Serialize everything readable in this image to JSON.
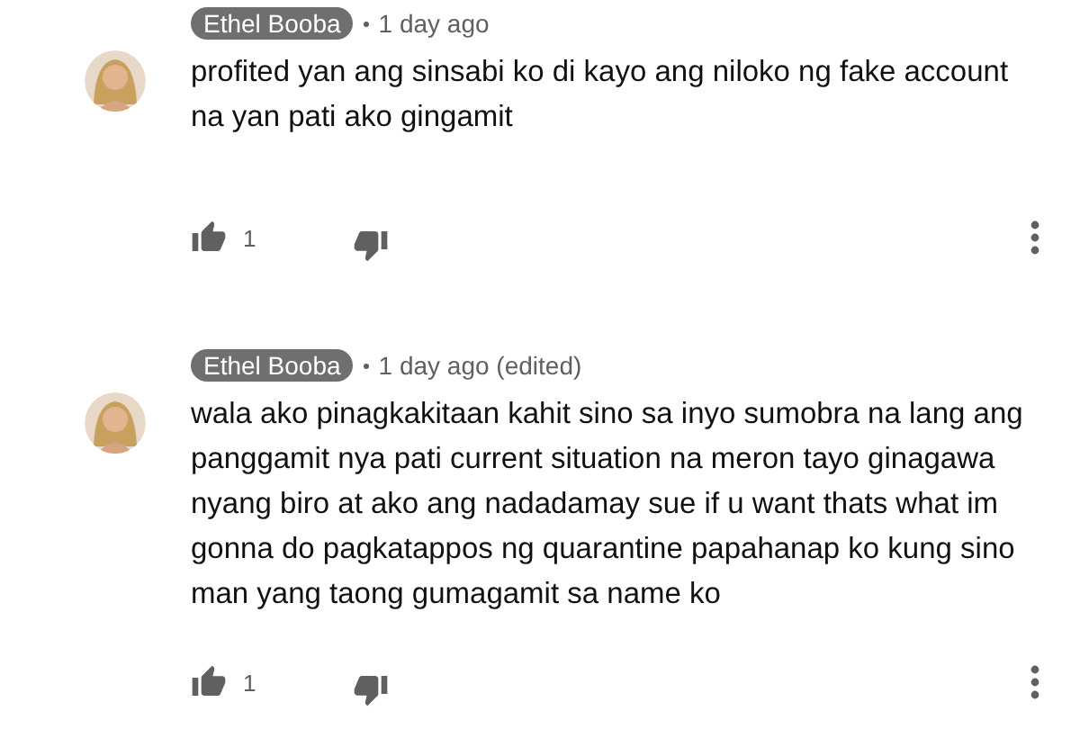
{
  "comments": [
    {
      "author": "Ethel Booba",
      "time": "1 day ago",
      "lines": [
        "profited yan ang sinsabi ko di kayo ang niloko ng fake account",
        "na yan pati ako gingamit"
      ],
      "likes": "1"
    },
    {
      "author": "Ethel Booba",
      "time": "1 day ago (edited)",
      "lines": [
        "wala ako pinagkakitaan kahit sino sa inyo sumobra na lang ang",
        "panggamit nya pati current situation na meron tayo ginagawa",
        "nyang biro at ako ang nadadamay sue if u want thats what im",
        "gonna do pagkatappos ng quarantine papahanap ko kung sino",
        "man yang taong gumagamit sa name ko"
      ],
      "likes": "1"
    }
  ]
}
